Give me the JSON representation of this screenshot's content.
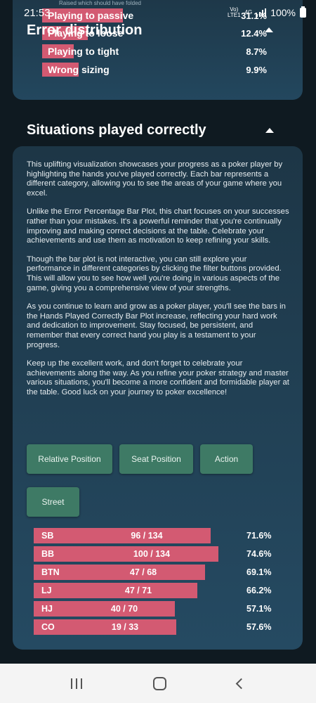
{
  "status_bar": {
    "time": "21:53",
    "network_top": "Vo)",
    "network_bottom": "LTE1",
    "net_type": "4G",
    "battery": "100%"
  },
  "error_distribution": {
    "title": "Error distribution",
    "faint_top_text": "Raised which should have folded",
    "rows": [
      {
        "label": "Playing to passive",
        "value": "31.1%",
        "fraction": 0.35
      },
      {
        "label": "Playing to loose",
        "value": "12.4%",
        "fraction": 0.2
      },
      {
        "label": "Playing to tight",
        "value": "8.7%",
        "fraction": 0.14
      },
      {
        "label": "Wrong sizing",
        "value": "9.9%",
        "fraction": 0.16
      }
    ]
  },
  "situations": {
    "title": "Situations played correctly",
    "paragraphs": [
      "This uplifting visualization showcases your progress as a poker player by highlighting the hands you've played correctly. Each bar represents a different category, allowing you to see the areas of your game where you excel.",
      "Unlike the Error Percentage Bar Plot, this chart focuses on your successes rather than your mistakes. It's a powerful reminder that you're continually improving and making correct decisions at the table. Celebrate your achievements and use them as motivation to keep refining your skills.",
      "Though the bar plot is not interactive, you can still explore your performance in different categories by clicking the filter buttons provided. This will allow you to see how well you're doing in various aspects of the game, giving you a comprehensive view of your strengths.",
      "As you continue to learn and grow as a poker player, you'll see the bars in the Hands Played Correctly Bar Plot increase, reflecting your hard work and dedication to improvement. Stay focused, be persistent, and remember that every correct hand you play is a testament to your progress.",
      "Keep up the excellent work, and don't forget to celebrate your achievements along the way. As you refine your poker strategy and master various situations, you'll become a more confident and formidable player at the table. Good luck on your journey to poker excellence!"
    ],
    "filters": {
      "relative_position": "Relative Position",
      "seat_position": "Seat Position",
      "action": "Action",
      "street": "Street"
    },
    "rows": [
      {
        "label": "SB",
        "fraction_text": "96 / 134",
        "percent": "71.6%",
        "value": 71.6
      },
      {
        "label": "BB",
        "fraction_text": "100 / 134",
        "percent": "74.6%",
        "value": 74.6
      },
      {
        "label": "BTN",
        "fraction_text": "47 / 68",
        "percent": "69.1%",
        "value": 69.1
      },
      {
        "label": "LJ",
        "fraction_text": "47 / 71",
        "percent": "66.2%",
        "value": 66.2
      },
      {
        "label": "HJ",
        "fraction_text": "40 / 70",
        "percent": "57.1%",
        "value": 57.1
      },
      {
        "label": "CO",
        "fraction_text": "19 / 33",
        "percent": "57.6%",
        "value": 57.6
      }
    ]
  },
  "colors": {
    "bar": "#d35a72",
    "button": "#3e7a65",
    "card": "#1d3646"
  }
}
